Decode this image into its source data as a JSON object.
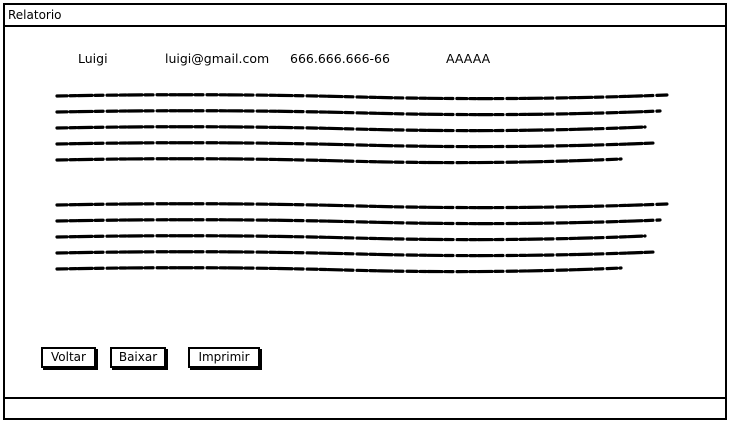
{
  "window": {
    "title": "Relatorio"
  },
  "record": {
    "name": "Luigi",
    "email": "luigi@gmail.com",
    "phone": "666.666.666-66",
    "code": "AAAAA"
  },
  "actions": {
    "back_label": "Voltar",
    "download_label": "Baixar",
    "print_label": "Imprimir"
  }
}
